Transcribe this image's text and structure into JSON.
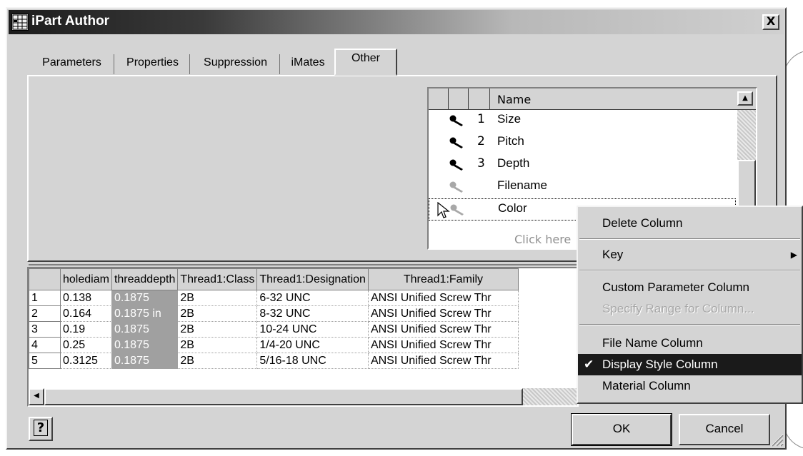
{
  "window": {
    "title": "iPart Author",
    "close_label": "X"
  },
  "tabs": [
    {
      "label": "Parameters"
    },
    {
      "label": "Properties"
    },
    {
      "label": "Suppression"
    },
    {
      "label": "iMates"
    },
    {
      "label": "Other",
      "active": true
    }
  ],
  "name_list": {
    "header": "Name",
    "rows": [
      {
        "num": "1",
        "name": "Size",
        "key": "active"
      },
      {
        "num": "2",
        "name": "Pitch",
        "key": "active"
      },
      {
        "num": "3",
        "name": "Depth",
        "key": "active"
      },
      {
        "num": "",
        "name": "Filename",
        "key": "inactive"
      },
      {
        "num": "",
        "name": "Color",
        "key": "inactive"
      }
    ],
    "add_row_hint": "Click here"
  },
  "grid": {
    "columns": [
      "holediam",
      "threaddepth",
      "Thread1:Class",
      "Thread1:Designation",
      "Thread1:Family"
    ],
    "rows": [
      {
        "n": "1",
        "cells": [
          "0.138",
          "0.1875",
          "2B",
          "6-32 UNC",
          "ANSI Unified Screw Thr"
        ]
      },
      {
        "n": "2",
        "cells": [
          "0.164",
          "0.1875 in",
          "2B",
          "8-32 UNC",
          "ANSI Unified Screw Thr"
        ]
      },
      {
        "n": "3",
        "cells": [
          "0.19",
          "0.1875",
          "2B",
          "10-24 UNC",
          "ANSI Unified Screw Thr"
        ]
      },
      {
        "n": "4",
        "cells": [
          "0.25",
          "0.1875",
          "2B",
          "1/4-20 UNC",
          "ANSI Unified Screw Thr"
        ]
      },
      {
        "n": "5",
        "cells": [
          "0.3125",
          "0.1875",
          "2B",
          "5/16-18 UNC",
          "ANSI Unified Screw Thr"
        ]
      }
    ]
  },
  "context_menu": {
    "delete_column": "Delete Column",
    "key": "Key",
    "custom_parameter_column": "Custom Parameter Column",
    "specify_range": "Specify Range for Column...",
    "file_name_column": "File Name Column",
    "display_style_column": "Display Style Column",
    "material_column": "Material Column",
    "checkmark": "✔",
    "submenu_arrow": "▶"
  },
  "buttons": {
    "help": "?",
    "ok": "OK",
    "cancel": "Cancel"
  }
}
